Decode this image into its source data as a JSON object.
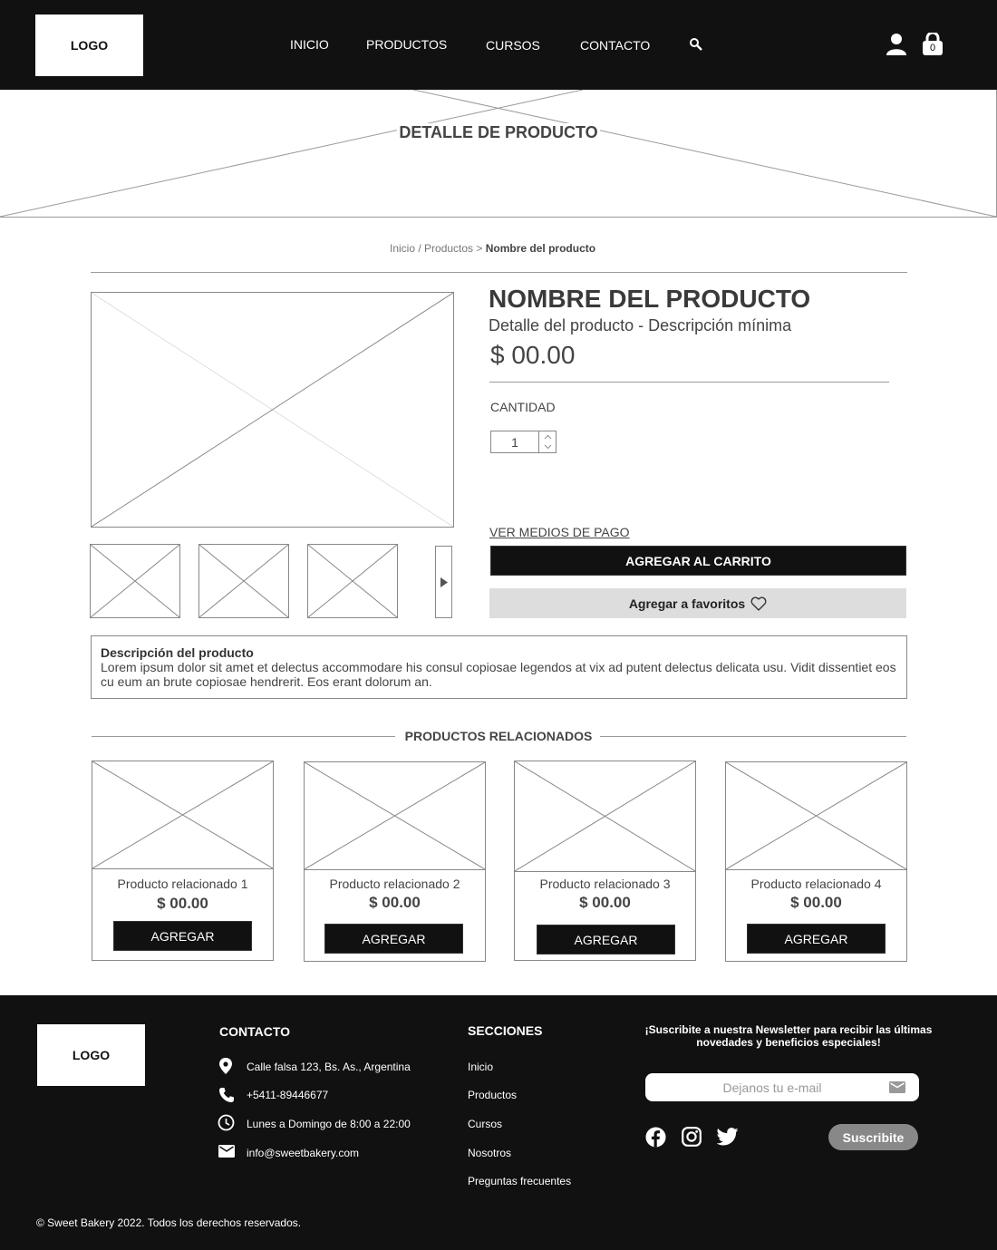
{
  "header": {
    "logo": "LOGO",
    "nav": [
      "INICIO",
      "PRODUCTOS",
      "CURSOS",
      "CONTACTO"
    ],
    "cart_count": "0",
    "icons": [
      "search-icon",
      "user-icon",
      "shopping-bag-icon"
    ]
  },
  "banner": {
    "title": "DETALLE DE PRODUCTO"
  },
  "breadcrumb": {
    "home": "Inicio",
    "sep1": " / ",
    "category": "Productos",
    "sep2": " > ",
    "current": "Nombre del producto"
  },
  "product": {
    "name": "NOMBRE DEL PRODUCTO",
    "subtitle": "Detalle del producto - Descripción mínima",
    "price": "$ 00.00",
    "quantity_label": "CANTIDAD",
    "quantity": "1",
    "payment_link": "VER MEDIOS DE PAGO",
    "add_to_cart": "AGREGAR AL CARRITO",
    "add_to_favorites": "Agregar a favoritos"
  },
  "description": {
    "title": "Descripción del producto",
    "text": "Lorem ipsum dolor sit amet et delectus accommodare his consul copiosae legendos at vix ad putent delectus delicata usu. Vidit dissentiet eos cu eum an brute copiosae hendrerit. Eos erant dolorum an."
  },
  "related": {
    "title": "PRODUCTOS RELACIONADOS",
    "items": [
      {
        "name": "Producto relacionado 1",
        "price": "$ 00.00",
        "button": "AGREGAR"
      },
      {
        "name": "Producto relacionado 2",
        "price": "$ 00.00",
        "button": "AGREGAR"
      },
      {
        "name": "Producto relacionado 3",
        "price": "$ 00.00",
        "button": "AGREGAR"
      },
      {
        "name": "Producto relacionado 4",
        "price": "$ 00.00",
        "button": "AGREGAR"
      }
    ]
  },
  "footer": {
    "logo": "LOGO",
    "contact_title": "CONTACTO",
    "address": "Calle falsa 123, Bs. As., Argentina",
    "phone": "+5411-89446677",
    "hours": "Lunes a Domingo de 8:00 a 22:00",
    "email": "info@sweetbakery.com",
    "sections_title": "SECCIONES",
    "sections": [
      "Inicio",
      "Productos",
      "Cursos",
      "Nosotros",
      "Preguntas frecuentes"
    ],
    "newsletter_text": "¡Suscribite a nuestra Newsletter para recibir las últimas novedades y beneficios especiales!",
    "email_placeholder": "Dejanos tu e-mail",
    "subscribe_button": "Suscribite",
    "social_icons": [
      "facebook-icon",
      "instagram-icon",
      "twitter-icon"
    ],
    "copyright": "© Sweet Bakery 2022. Todos los derechos reservados."
  },
  "colors": {
    "dark": "#111111",
    "placeholder_line": "#888888",
    "fav_bg": "#dddddd",
    "subscribe_bg": "#888888"
  }
}
